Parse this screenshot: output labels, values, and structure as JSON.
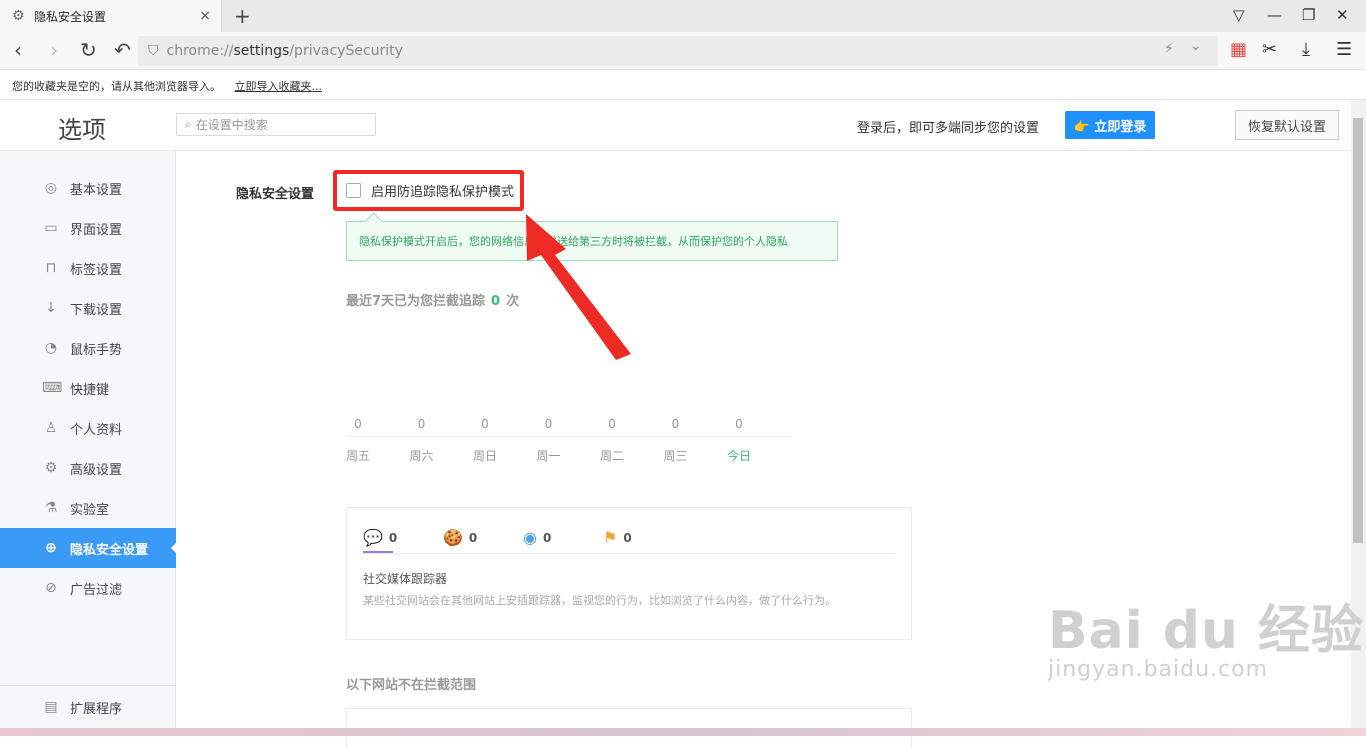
{
  "tab": {
    "title": "隐私安全设置",
    "close": "×",
    "new_tab": "+"
  },
  "window": {
    "skin": "▽",
    "minimize": "—",
    "restore": "❐",
    "close": "✕"
  },
  "nav": {
    "back": "‹",
    "forward": "›",
    "reload": "↻",
    "undo": "↶",
    "url_scheme": "chrome://",
    "url_host": "settings",
    "url_path": "/privacySecurity",
    "lightning": "⚡",
    "dropdown": "⌄",
    "apps": "▦",
    "cut": "✂",
    "download": "⤓",
    "menu": "☰"
  },
  "bookmarks": {
    "message": "您的收藏夹是空的，请从其他浏览器导入。",
    "import_link": "立即导入收藏夹..."
  },
  "header": {
    "brand": "选项",
    "search_placeholder": "在设置中搜索",
    "sync_text": "登录后，即可多端同步您的设置",
    "login_button": "👉 立即登录",
    "reset_button": "恢复默认设置"
  },
  "sidebar": {
    "items": [
      {
        "label": "基本设置",
        "icon": "◎"
      },
      {
        "label": "界面设置",
        "icon": "▭"
      },
      {
        "label": "标签设置",
        "icon": "⊓"
      },
      {
        "label": "下载设置",
        "icon": "↓"
      },
      {
        "label": "鼠标手势",
        "icon": "◔"
      },
      {
        "label": "快捷键",
        "icon": "⌨"
      },
      {
        "label": "个人资料",
        "icon": "♙"
      },
      {
        "label": "高级设置",
        "icon": "⚙"
      },
      {
        "label": "实验室",
        "icon": "⚗"
      },
      {
        "label": "隐私安全设置",
        "icon": "⊕"
      },
      {
        "label": "广告过滤",
        "icon": "⊘"
      }
    ],
    "extensions": {
      "label": "扩展程序",
      "icon": "▤"
    }
  },
  "privacy": {
    "section_title": "隐私安全设置",
    "checkbox_label": "启用防追踪隐私保护模式",
    "checkbox_checked": false,
    "tip": "隐私保护模式开启后，您的网络信息在发送给第三方时将被拦截，从而保护您的个人隐私",
    "count_prefix": "最近7天已为您拦截追踪",
    "count_value": "0",
    "count_suffix": "次"
  },
  "chart_data": {
    "type": "line",
    "categories": [
      "周五",
      "周六",
      "周日",
      "周一",
      "周二",
      "周三",
      "今日"
    ],
    "values": [
      0,
      0,
      0,
      0,
      0,
      0,
      0
    ],
    "highlight_color": "#3bbf77"
  },
  "trackers": {
    "stats": [
      {
        "icon": "💬",
        "value": "0",
        "color": "#9b7de0"
      },
      {
        "icon": "🍪",
        "value": "0",
        "color": "#2bb3c9"
      },
      {
        "icon": "◉",
        "value": "0",
        "color": "#4aa3e8"
      },
      {
        "icon": "⚑",
        "value": "0",
        "color": "#f0a53a"
      }
    ],
    "title": "社交媒体跟踪器",
    "desc": "某些社交网站会在其他网站上安插跟踪器，监视您的行为，比如浏览了什么内容，做了什么行为。"
  },
  "exceptions": {
    "title": "以下网站不在拦截范围"
  },
  "watermark": {
    "line1": "Bai du 经验",
    "line2": "jingyan.baidu.com"
  }
}
